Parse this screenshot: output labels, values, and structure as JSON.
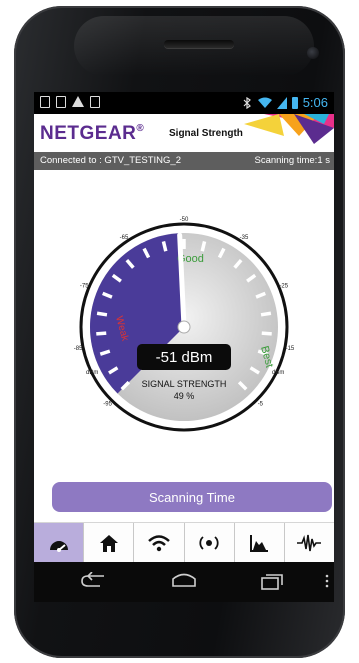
{
  "statusbar": {
    "time": "5:06"
  },
  "header": {
    "brand": "NETGEAR",
    "title": "Signal Strength"
  },
  "infobar": {
    "connected": "Connected to : GTV_TESTING_2",
    "scanning": "Scanning time:1 s"
  },
  "gauge": {
    "reading": "-51 dBm",
    "label": "SIGNAL STRENGTH",
    "percent": "49 %",
    "zone_good": "Good",
    "zone_best": "Best",
    "zone_weak": "Weak",
    "unit_left": "dBm",
    "unit_right": "dBm",
    "ticks": [
      "-95",
      "-85",
      "-75",
      "-65",
      "-50",
      "-35",
      "-25",
      "-15",
      "-5"
    ],
    "value_fraction": 0.49
  },
  "actions": {
    "scan_label": "Scanning Time"
  },
  "toolbar": {
    "items": [
      {
        "icon": "gauge-icon"
      },
      {
        "icon": "home-icon"
      },
      {
        "icon": "wifi-icon"
      },
      {
        "icon": "target-icon"
      },
      {
        "icon": "chart-icon"
      },
      {
        "icon": "waveform-icon"
      }
    ]
  },
  "colors": {
    "brand": "#5b2c8f",
    "accent": "#8e79c2",
    "statusbar": "#45b6f0",
    "gauge_fill": "#4a3b99"
  }
}
